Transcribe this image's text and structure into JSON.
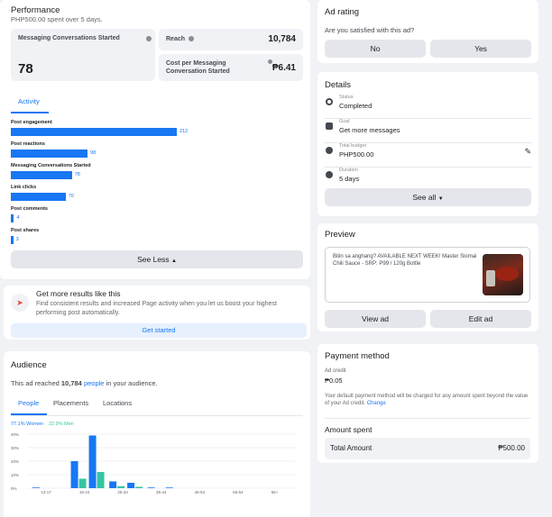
{
  "performance": {
    "title": "Performance",
    "subtitle": "PHP500.00 spent over 5 days.",
    "stats": {
      "messaging_label": "Messaging Conversations Started",
      "messaging_value": "78",
      "reach_label": "Reach",
      "reach_value": "10,784",
      "cost_label": "Cost per Messaging Conversation Started",
      "cost_value": "₱6.41"
    },
    "tab_activity": "Activity",
    "bars": [
      {
        "label": "Post engagement",
        "value": 212
      },
      {
        "label": "Post reactions",
        "value": 98
      },
      {
        "label": "Messaging Conversations Started",
        "value": 78
      },
      {
        "label": "Link clicks",
        "value": 70
      },
      {
        "label": "Post comments",
        "value": 4
      },
      {
        "label": "Post shares",
        "value": 3
      }
    ],
    "see_less": "See Less"
  },
  "boost": {
    "title": "Get more results like this",
    "desc": "Find consistent results and increased Page activity when you let us boost your highest performing post automatically.",
    "cta": "Get started"
  },
  "audience": {
    "title": "Audience",
    "reach_pre": "This ad reached",
    "reach_num": "10,784",
    "reach_link": "people",
    "reach_post": "in your audience.",
    "tabs": [
      "People",
      "Placements",
      "Locations"
    ],
    "legend_women": "77.1% Women",
    "legend_men": "22.9% Men",
    "color_women": "#1877f2",
    "color_men": "#36c4a1",
    "y_ticks": [
      "40%",
      "30%",
      "20%",
      "10%",
      "0%"
    ],
    "age_groups": [
      "13-17",
      "18-24",
      "25-34",
      "35-44",
      "45-54",
      "55-64",
      "65+"
    ]
  },
  "chart_data": {
    "type": "bar",
    "categories": [
      "13-17",
      "18-24",
      "25-34",
      "35-44",
      "45-54",
      "55-64",
      "65+"
    ],
    "series": [
      {
        "name": "77.1% Women",
        "values": [
          0.5,
          20,
          5,
          0.5,
          0,
          0,
          0
        ]
      },
      {
        "name": "22.9% Men",
        "values": [
          0,
          7,
          1.5,
          0,
          0,
          0,
          0
        ]
      },
      {
        "name": "77.1% Women",
        "values": [
          0,
          39,
          4,
          0.5,
          0,
          0,
          0
        ]
      },
      {
        "name": "22.9% Men",
        "values": [
          0,
          12,
          1,
          0,
          0,
          0,
          0
        ]
      }
    ],
    "ylim": [
      0,
      40
    ],
    "y_ticks": [
      "40%",
      "30%",
      "20%",
      "10%",
      "0%"
    ]
  },
  "rating": {
    "title": "Ad rating",
    "question": "Are you satisfied with this ad?",
    "no": "No",
    "yes": "Yes"
  },
  "details": {
    "title": "Details",
    "rows": [
      {
        "key": "Status",
        "value": "Completed",
        "icon": "status-icon"
      },
      {
        "key": "Goal",
        "value": "Get more messages",
        "icon": "goal-icon"
      },
      {
        "key": "Total budget",
        "value": "PHP500.00",
        "icon": "budget-icon"
      },
      {
        "key": "Duration",
        "value": "5 days",
        "icon": "clock-icon"
      }
    ],
    "see_all": "See all"
  },
  "preview": {
    "title": "Preview",
    "text": "Bitin sa anghang? AVAILABLE NEXT WEEK! Master Siomai Chili Sauce - SRP: P99 / 120g Bottle",
    "view": "View ad",
    "edit": "Edit ad"
  },
  "payment": {
    "title": "Payment method",
    "credit_label": "Ad credit",
    "credit_value": "₱0.05",
    "note": "Your default payment method will be charged for any amount spent beyond the value of your Ad credit.",
    "change": "Change"
  },
  "amount": {
    "title": "Amount spent",
    "total_label": "Total Amount",
    "total_value": "₱500.00"
  }
}
